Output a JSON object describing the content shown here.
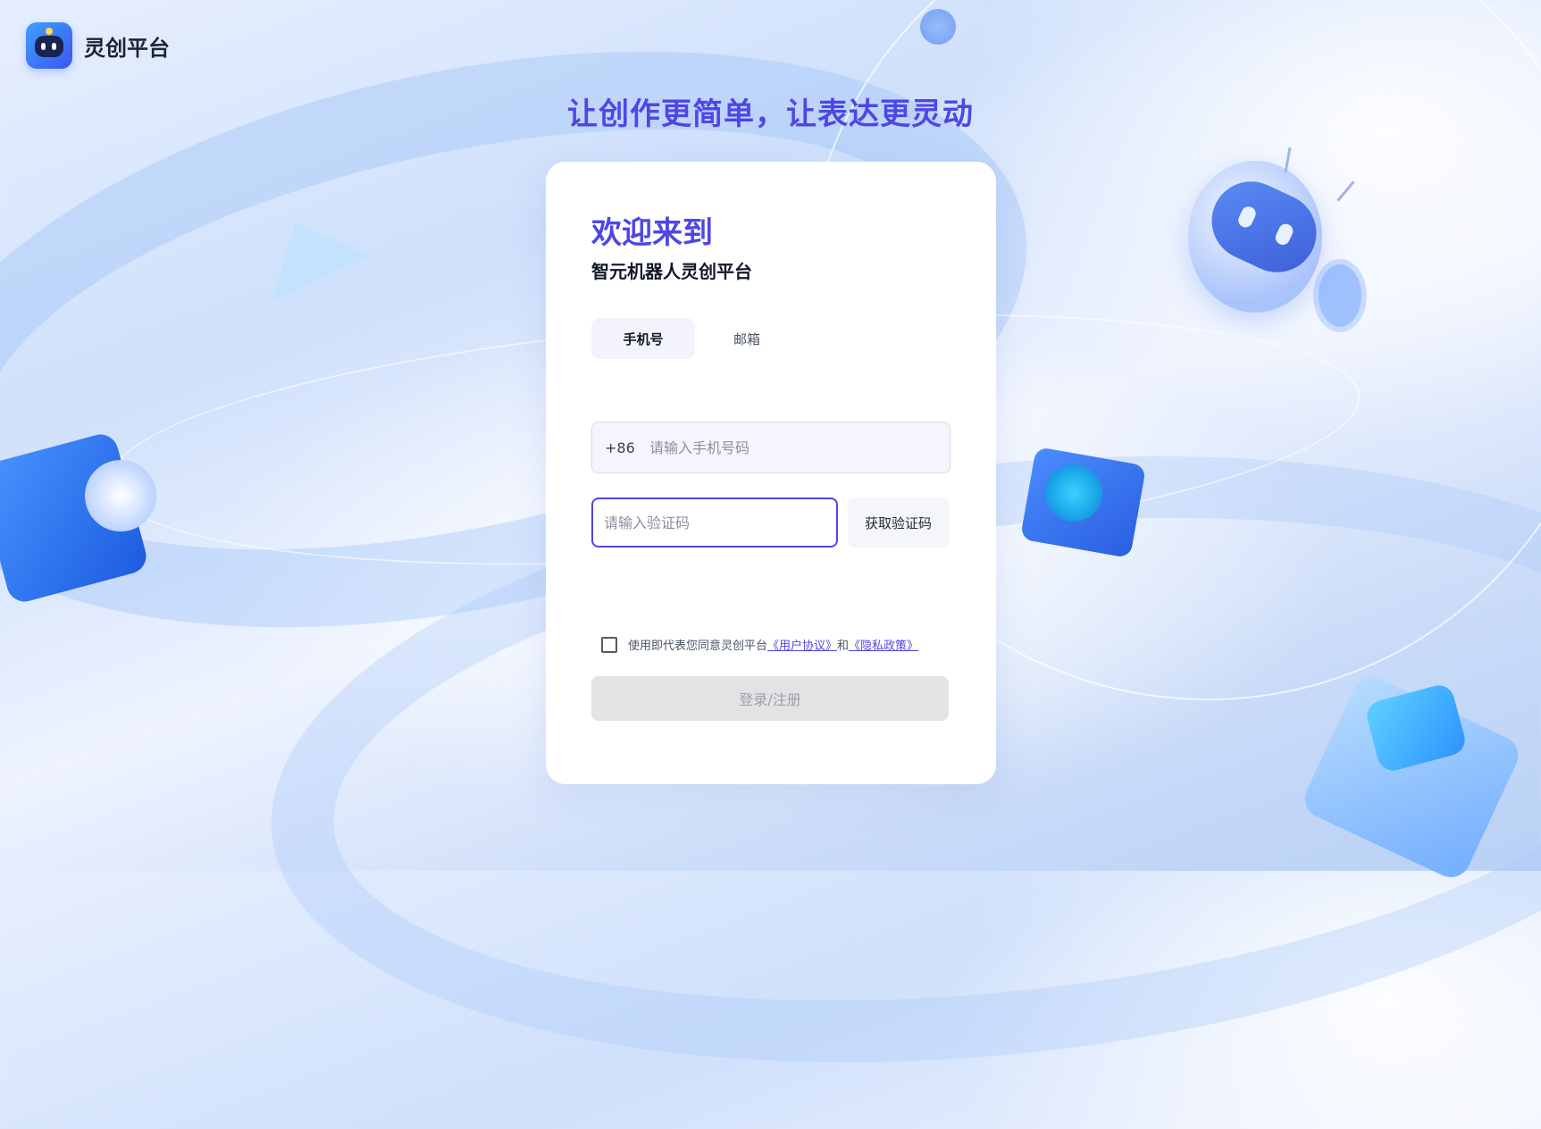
{
  "brand": {
    "name": "灵创平台"
  },
  "slogan": "让创作更简单，让表达更灵动",
  "card": {
    "welcome": "欢迎来到",
    "subtitle": "智元机器人灵创平台",
    "tabs": [
      {
        "label": "手机号",
        "active": true
      },
      {
        "label": "邮箱",
        "active": false
      }
    ],
    "phone": {
      "prefix": "+86",
      "placeholder": "请输入手机号码",
      "value": ""
    },
    "code": {
      "placeholder": "请输入验证码",
      "value": "",
      "button_label": "获取验证码"
    },
    "agreement": {
      "checked": false,
      "text": "使用即代表您同意灵创平台",
      "user_agreement": "《用户协议》",
      "and": "和",
      "privacy_policy": "《隐私政策》"
    },
    "submit_label": "登录/注册"
  },
  "colors": {
    "accent": "#4f46e5",
    "submit_disabled": "#e3e3e5"
  }
}
